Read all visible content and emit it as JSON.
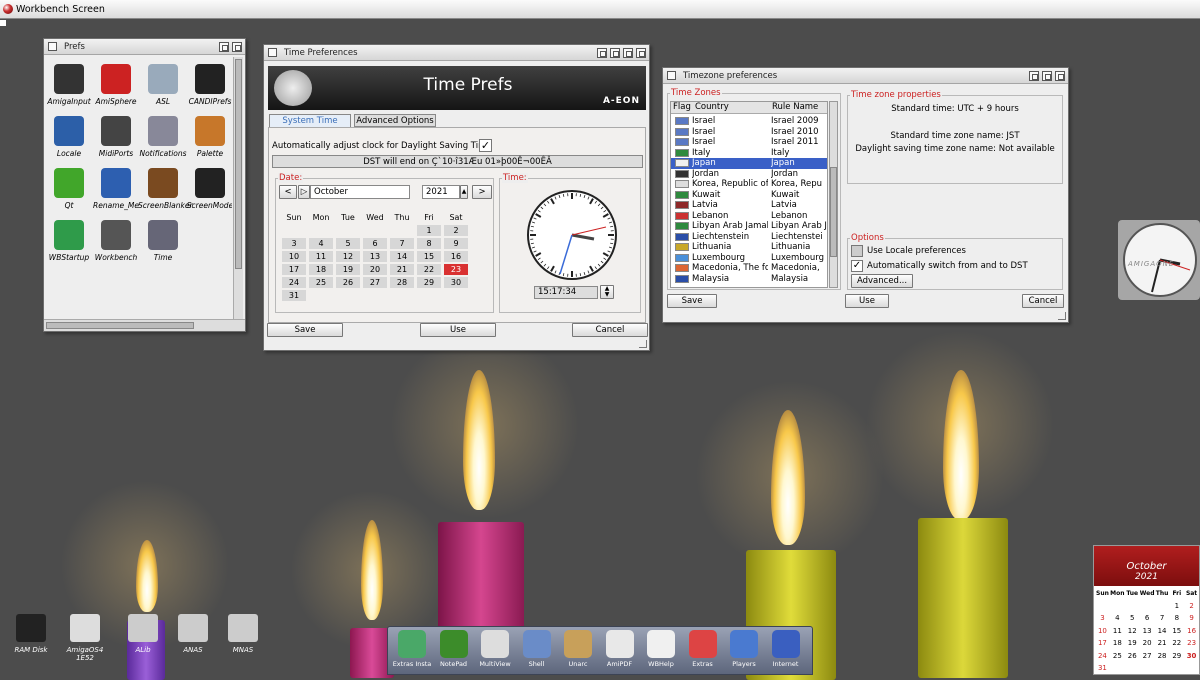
{
  "screen": {
    "title": "Workbench Screen"
  },
  "prefs_window": {
    "title": "Prefs",
    "icons": [
      {
        "label": "AmigaInput",
        "icon": "joystick-icon",
        "color": "#333"
      },
      {
        "label": "AmiSphere",
        "icon": "boing-ball-icon",
        "color": "#c22"
      },
      {
        "label": "ASL",
        "icon": "file-requester-icon",
        "color": "#9ab"
      },
      {
        "label": "CANDIPrefs",
        "icon": "monitor-icon",
        "color": "#222"
      },
      {
        "label": "Locale",
        "icon": "globe-icon",
        "color": "#2c5fa8"
      },
      {
        "label": "MidiPorts",
        "icon": "midi-plug-icon",
        "color": "#444"
      },
      {
        "label": "Notifications",
        "icon": "notifications-icon",
        "color": "#889"
      },
      {
        "label": "Palette",
        "icon": "palette-icon",
        "color": "#c7772a"
      },
      {
        "label": "Qt",
        "icon": "qt-logo-icon",
        "color": "#41a62a"
      },
      {
        "label": "Rename_Me",
        "icon": "blue-disk-icon",
        "color": "#2d5fb0"
      },
      {
        "label": "ScreenBlanker",
        "icon": "screen-blanker-icon",
        "color": "#7a4a20"
      },
      {
        "label": "ScreenMode",
        "icon": "screen-mode-icon",
        "color": "#222"
      },
      {
        "label": "WBStartup",
        "icon": "power-icon",
        "color": "#2f9b4a"
      },
      {
        "label": "Workbench",
        "icon": "workbench-icon",
        "color": "#555"
      },
      {
        "label": "Time",
        "icon": "clock-icon",
        "color": "#667"
      }
    ]
  },
  "time_prefs": {
    "title": "Time Preferences",
    "banner": "Time Prefs",
    "brand": "A-EON",
    "tabs": [
      "System Time",
      "Advanced Options"
    ],
    "dst_label": "Automatically adjust clock for Daylight Saving Time",
    "dst_info": "DST will end on Ç`10·î31Æu 01»þ00Ê¬00ÊÂ",
    "date_legend": "Date:",
    "time_legend": "Time:",
    "month": "October",
    "year": "2021",
    "weekdays": [
      "Sun",
      "Mon",
      "Tue",
      "Wed",
      "Thu",
      "Fri",
      "Sat"
    ],
    "days": [
      "",
      "",
      "",
      "",
      "",
      "1",
      "2",
      "3",
      "4",
      "5",
      "6",
      "7",
      "8",
      "9",
      "10",
      "11",
      "12",
      "13",
      "14",
      "15",
      "16",
      "17",
      "18",
      "19",
      "20",
      "21",
      "22",
      "23",
      "24",
      "25",
      "26",
      "27",
      "28",
      "29",
      "30",
      "31"
    ],
    "selected_day": "23",
    "time_value": "15:17:34",
    "buttons": {
      "save": "Save",
      "use": "Use",
      "cancel": "Cancel"
    }
  },
  "tz_prefs": {
    "title": "Timezone preferences",
    "list_legend": "Time Zones",
    "columns": [
      "Flag",
      "Country",
      "Rule Name"
    ],
    "rows": [
      {
        "country": "Israel",
        "rule": "Israel 2009",
        "flag": "#5a79c4"
      },
      {
        "country": "Israel",
        "rule": "Israel 2010",
        "flag": "#5a79c4"
      },
      {
        "country": "Israel",
        "rule": "Israel 2011",
        "flag": "#5a79c4"
      },
      {
        "country": "Italy",
        "rule": "Italy",
        "flag": "#2f8a3e"
      },
      {
        "country": "Japan",
        "rule": "Japan",
        "flag": "#f0f0f0"
      },
      {
        "country": "Jordan",
        "rule": "Jordan",
        "flag": "#333"
      },
      {
        "country": "Korea, Republic of",
        "rule": "Korea, Repu",
        "flag": "#ddd"
      },
      {
        "country": "Kuwait",
        "rule": "Kuwait",
        "flag": "#2f8a3e"
      },
      {
        "country": "Latvia",
        "rule": "Latvia",
        "flag": "#8e2a2a"
      },
      {
        "country": "Lebanon",
        "rule": "Lebanon",
        "flag": "#c33"
      },
      {
        "country": "Libyan Arab Jamahiriya",
        "rule": "Libyan Arab J",
        "flag": "#2f8a3e"
      },
      {
        "country": "Liechtenstein",
        "rule": "Liechtenstei",
        "flag": "#2a4ea8"
      },
      {
        "country": "Lithuania",
        "rule": "Lithuania",
        "flag": "#c8a82a"
      },
      {
        "country": "Luxembourg",
        "rule": "Luxembourg",
        "flag": "#4a90d9"
      },
      {
        "country": "Macedonia, The former",
        "rule": "Macedonia,",
        "flag": "#d63"
      },
      {
        "country": "Malaysia",
        "rule": "Malaysia",
        "flag": "#2a4ea8"
      }
    ],
    "selected_country": "Japan",
    "props_legend": "Time zone properties",
    "standard_time": "Standard time: UTC + 9 hours",
    "std_name": "Standard time zone name: JST",
    "dst_name": "Daylight saving time zone name: Not available",
    "options_legend": "Options",
    "use_locale": "Use Locale preferences",
    "auto_dst": "Automatically switch from and to DST",
    "advanced": "Advanced...",
    "buttons": {
      "save": "Save",
      "use": "Use",
      "cancel": "Cancel"
    }
  },
  "clock_widget": {
    "brand": "AMIGAONE"
  },
  "dock": {
    "items": [
      "Extras Insta",
      "NotePad",
      "MultiView",
      "Shell",
      "Unarc",
      "AmiPDF",
      "WBHelp",
      "Extras",
      "Players",
      "Internet"
    ]
  },
  "desktop_icons": [
    "RAM Disk",
    "AmigaOS4 1E52",
    "ALib",
    "ANAS",
    "MNAS"
  ],
  "mini_calendar": {
    "month": "October",
    "year": "2021",
    "weekdays": [
      "Sun",
      "Mon",
      "Tue",
      "Wed",
      "Thu",
      "Fri",
      "Sat"
    ],
    "days": [
      "",
      "",
      "",
      "",
      "",
      "1",
      "2",
      "3",
      "4",
      "5",
      "6",
      "7",
      "8",
      "9",
      "10",
      "11",
      "12",
      "13",
      "14",
      "15",
      "16",
      "17",
      "18",
      "19",
      "20",
      "21",
      "22",
      "23",
      "24",
      "25",
      "26",
      "27",
      "28",
      "29",
      "30",
      "31"
    ],
    "today": "30"
  }
}
